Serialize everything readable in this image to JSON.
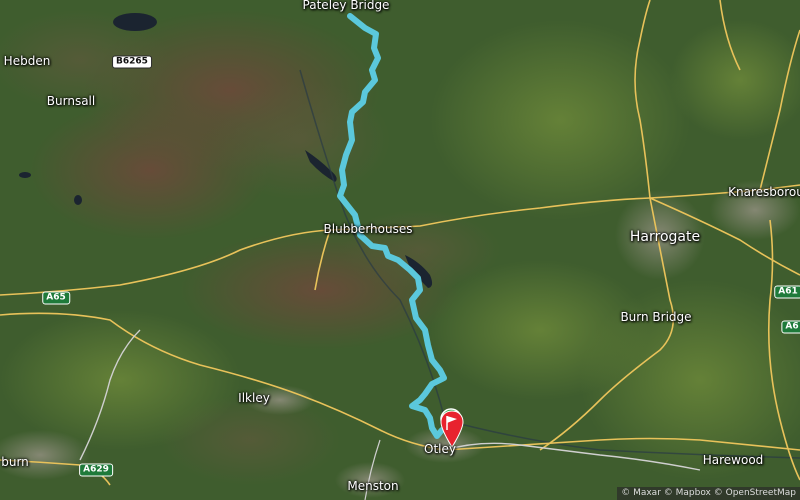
{
  "map": {
    "places": [
      {
        "id": "pateley-bridge",
        "label": "Pateley Bridge"
      },
      {
        "id": "hebden",
        "label": "Hebden"
      },
      {
        "id": "burnsall",
        "label": "Burnsall"
      },
      {
        "id": "blubberhouses",
        "label": "Blubberhouses"
      },
      {
        "id": "harrogate",
        "label": "Harrogate"
      },
      {
        "id": "knaresborough",
        "label": "Knaresborou"
      },
      {
        "id": "burn-bridge",
        "label": "Burn Bridge"
      },
      {
        "id": "ilkley",
        "label": "Ilkley"
      },
      {
        "id": "otley",
        "label": "Otley"
      },
      {
        "id": "menston",
        "label": "Menston"
      },
      {
        "id": "harewood",
        "label": "Harewood"
      },
      {
        "id": "burn-left",
        "label": "burn"
      }
    ],
    "road_shields": [
      {
        "id": "b6265",
        "label": "B6265",
        "style": "white"
      },
      {
        "id": "a65",
        "label": "A65",
        "style": "green"
      },
      {
        "id": "a629",
        "label": "A629",
        "style": "green"
      },
      {
        "id": "a61",
        "label": "A61",
        "style": "green"
      },
      {
        "id": "a6",
        "label": "A6",
        "style": "green"
      }
    ],
    "route_color": "#5bc8dc",
    "road_color": "#e8c25a",
    "attribution": "© Maxar © Mapbox © OpenStreetMap"
  }
}
